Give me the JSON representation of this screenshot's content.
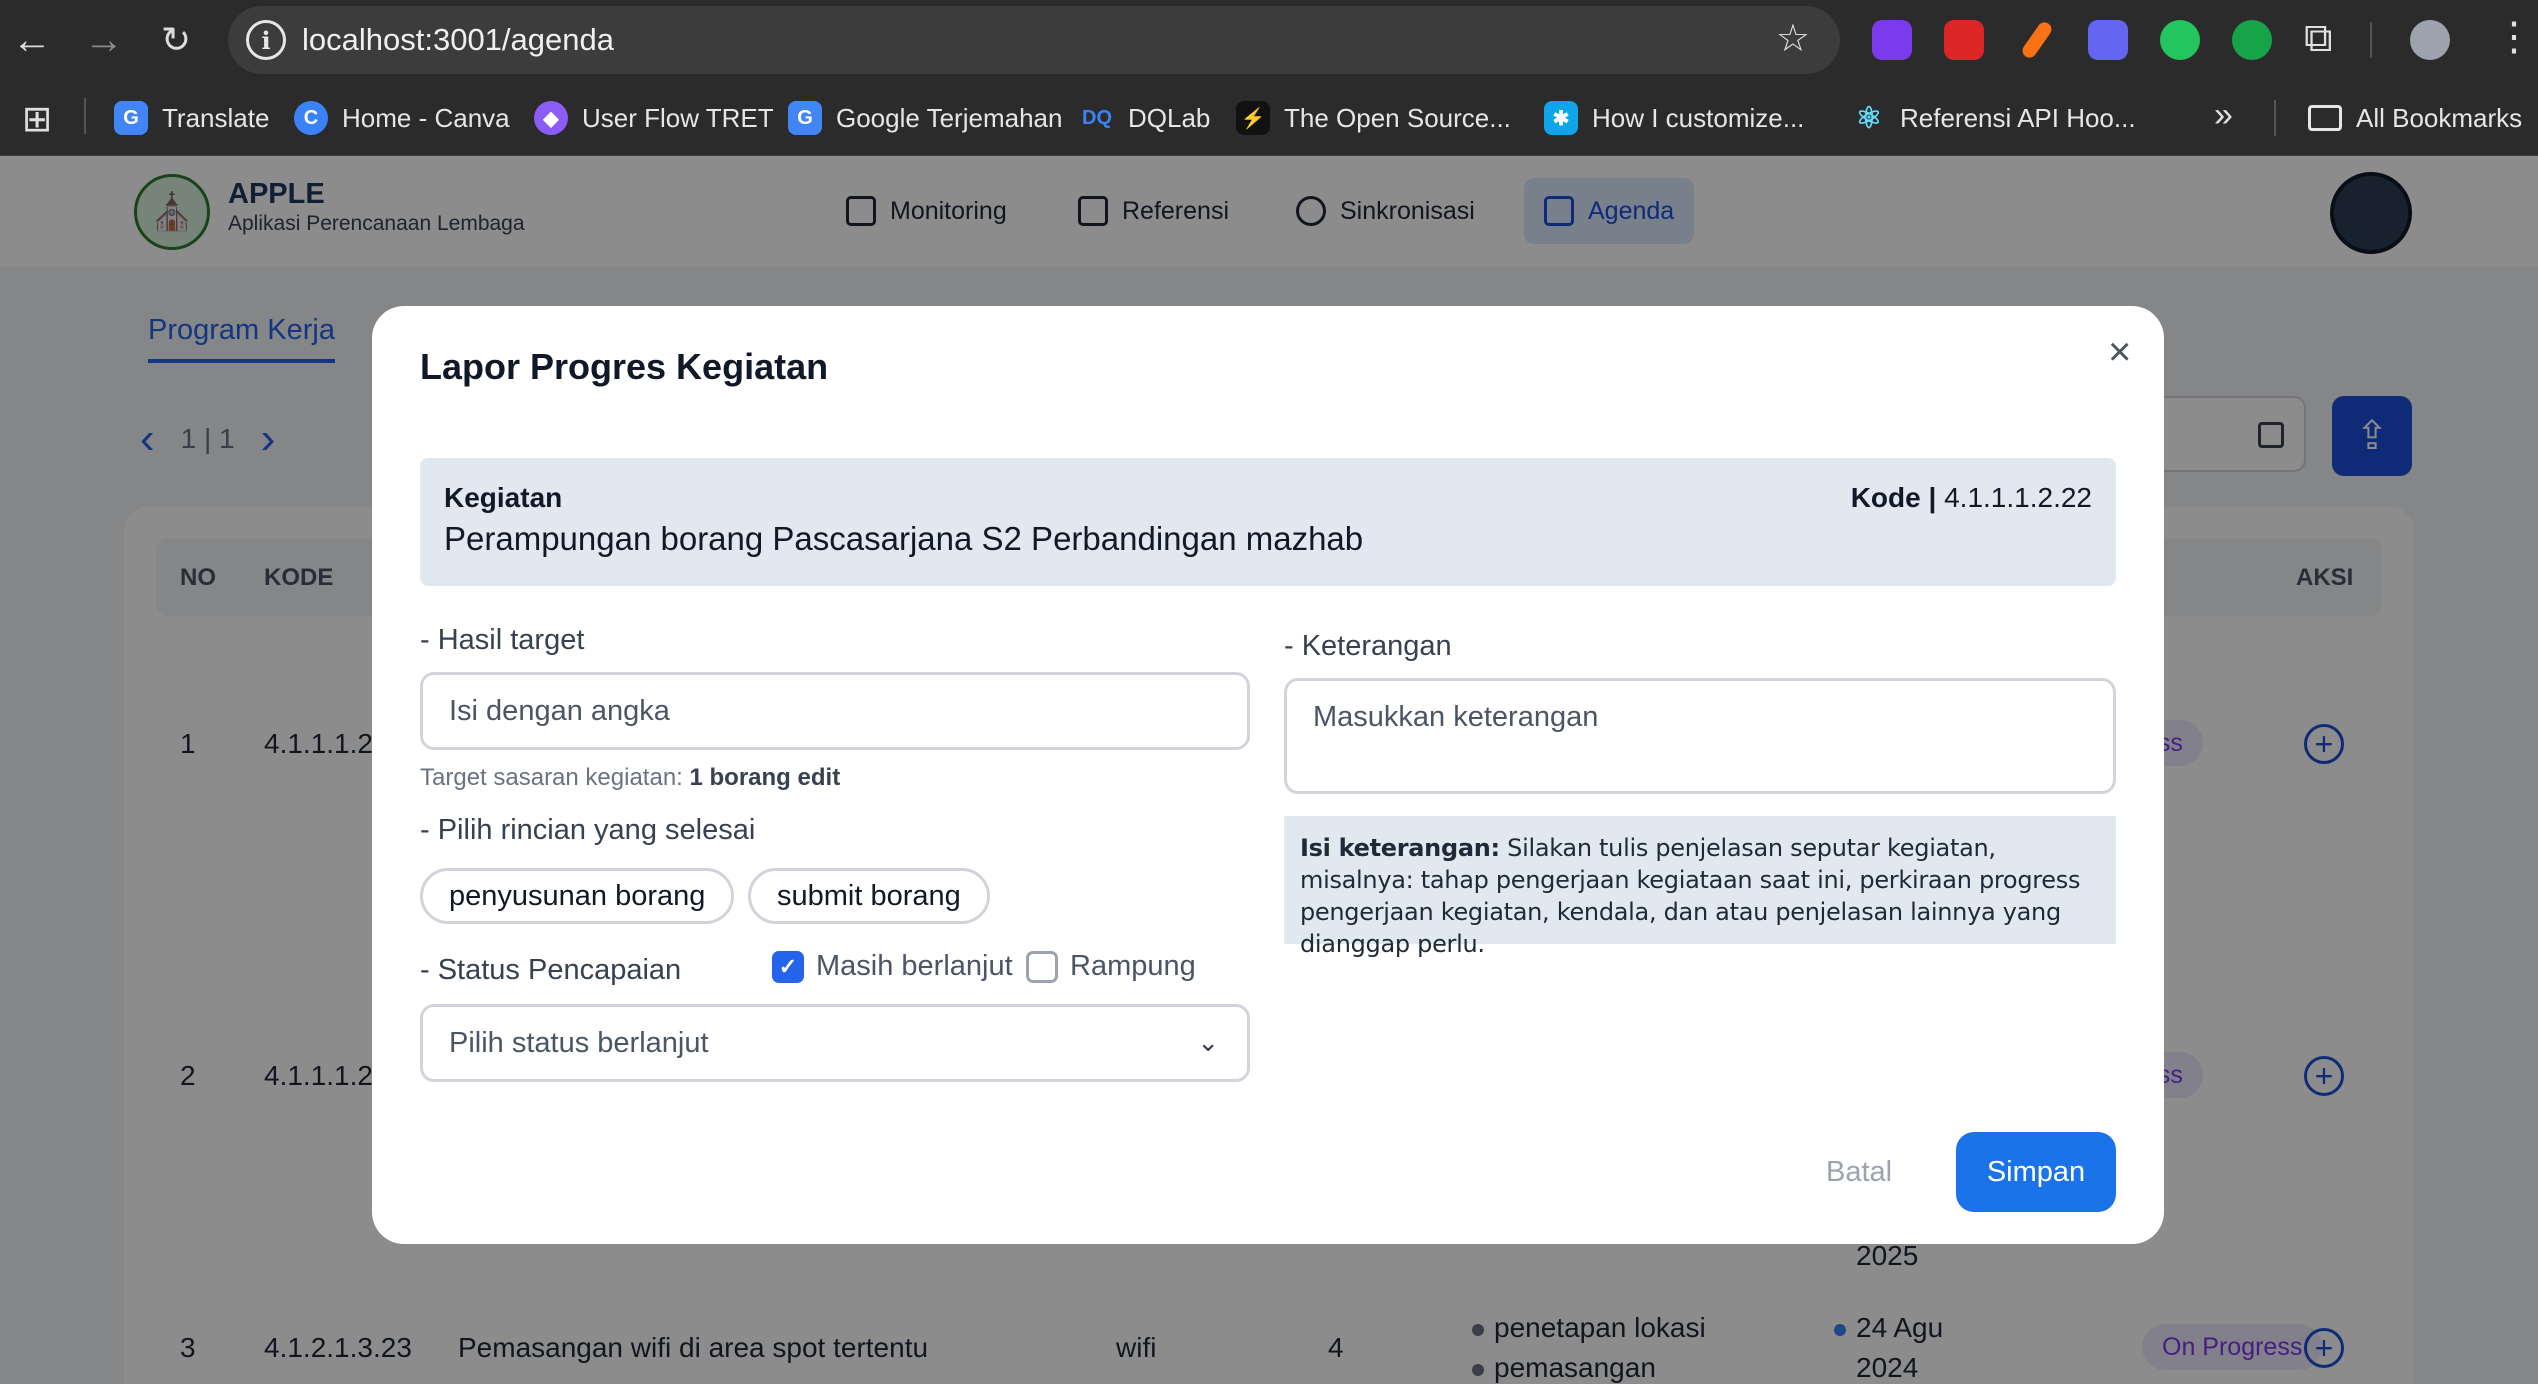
{
  "browser": {
    "url": "localhost:3001/agenda",
    "bookmarks": [
      {
        "label": "Translate",
        "color": "#4285f4"
      },
      {
        "label": "Home - Canva",
        "color": "#3b82f6"
      },
      {
        "label": "User Flow TRET",
        "color": "#8b5cf6"
      },
      {
        "label": "Google Terjemahan",
        "color": "#4285f4"
      },
      {
        "label": "DQLab",
        "color": "#3b82f6"
      },
      {
        "label": "The Open Source...",
        "color": "#22c55e"
      },
      {
        "label": "How I customize...",
        "color": "#38bdf8"
      },
      {
        "label": "Referensi API Hoo...",
        "color": "#61dafb"
      }
    ],
    "all_bookmarks": "All Bookmarks"
  },
  "app": {
    "name": "APPLE",
    "subtitle": "Aplikasi Perencanaan Lembaga",
    "menu": [
      {
        "label": "Monitoring",
        "active": false
      },
      {
        "label": "Referensi",
        "active": false
      },
      {
        "label": "Sinkronisasi",
        "active": false
      },
      {
        "label": "Agenda",
        "active": true
      }
    ],
    "tab": "Program Kerja",
    "pager": "1 | 1",
    "table": {
      "headers": {
        "no": "NO",
        "kode": "KODE",
        "aksi": "AKSI"
      },
      "rows": [
        {
          "no": "1",
          "kode": "4.1.1.1.2.",
          "status": "ess"
        },
        {
          "no": "2",
          "kode": "4.1.1.1.2.",
          "status": "ess",
          "year": "2025"
        },
        {
          "no": "3",
          "kode": "4.1.2.1.3.23",
          "name": "Pemasangan wifi di area spot tertentu",
          "target": "wifi",
          "qty": "4",
          "items": [
            "penetapan lokasi",
            "pemasangan"
          ],
          "date1": "24 Agu",
          "date2": "2024",
          "status": "On Progress"
        }
      ]
    }
  },
  "modal": {
    "title": "Lapor Progres Kegiatan",
    "close": "×",
    "kegiatan_label": "Kegiatan",
    "kegiatan_name": "Perampungan borang Pascasarjana S2 Perbandingan mazhab",
    "kode_label": "Kode |",
    "kode_value": " 4.1.1.1.2.22",
    "hasil_label": "- Hasil target",
    "hasil_placeholder": "Isi dengan angka",
    "target_hint_prefix": "Target sasaran kegiatan: ",
    "target_hint_value": "1 borang edit",
    "rincian_label": "- Pilih rincian yang selesai",
    "rincian_options": [
      "penyusunan borang",
      "submit borang"
    ],
    "status_label": "- Status Pencapaian",
    "status_options": [
      {
        "label": "Masih berlanjut",
        "checked": true
      },
      {
        "label": "Rampung",
        "checked": false
      }
    ],
    "status_select": "Pilih status berlanjut",
    "keterangan_label": "- Keterangan",
    "keterangan_placeholder": "Masukkan keterangan",
    "help_bold": "Isi keterangan:",
    "help_text": " Silakan tulis penjelasan seputar kegiatan, misalnya: tahap pengerjaan kegiataan saat ini, perkiraan progress pengerjaan kegiatan, kendala, dan atau penjelasan lainnya yang dianggap perlu.",
    "cancel": "Batal",
    "save": "Simpan"
  }
}
